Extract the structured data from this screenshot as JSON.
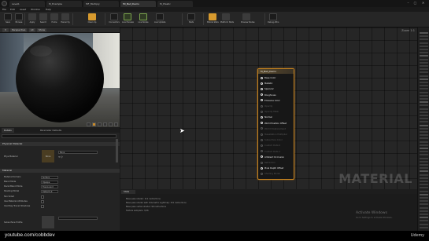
{
  "tabs": [
    "Level1",
    "M_Example",
    "MF_Multiply",
    "MI_Ball_Demo",
    "M_Plastic"
  ],
  "window_controls": [
    "–",
    "▢",
    "✕"
  ],
  "menu": [
    "File",
    "Edit",
    "Asset",
    "Window",
    "Help"
  ],
  "toolbar": [
    {
      "label": "Save",
      "icon": "save-icon",
      "style": "dk"
    },
    {
      "label": "Browse",
      "icon": "browse-icon",
      "style": "dk"
    },
    {
      "label": "Apply",
      "icon": "apply-icon",
      "style": ""
    },
    {
      "label": "Search",
      "icon": "search-icon",
      "style": ""
    },
    {
      "label": "Home",
      "icon": "home-icon",
      "style": ""
    },
    {
      "label": "Hierarchy",
      "icon": "hierarchy-icon",
      "style": ""
    },
    {
      "label": "Clean Up",
      "icon": "cleanup-icon",
      "style": "hl"
    },
    {
      "label": "Connectors",
      "icon": "connectors-icon",
      "style": "dk"
    },
    {
      "label": "Live Preview",
      "icon": "live-preview-icon",
      "style": "grn"
    },
    {
      "label": "Live Nodes",
      "icon": "live-nodes-icon",
      "style": "grn"
    },
    {
      "label": "Live Update",
      "icon": "live-update-icon",
      "style": "dk"
    },
    {
      "label": "Stats",
      "icon": "stats-icon",
      "style": "dk"
    },
    {
      "label": "Mobile Stats",
      "icon": "mobile-stats-icon",
      "style": "hl"
    },
    {
      "label": "Platform Stats",
      "icon": "platform-stats-icon",
      "style": ""
    },
    {
      "label": "Preview Nodes",
      "icon": "preview-nodes-icon",
      "style": ""
    },
    {
      "label": "Debug Attrs",
      "icon": "debug-icon",
      "style": "dk"
    }
  ],
  "viewport": {
    "tabs": [
      "Perspective",
      "Lit",
      "Show"
    ]
  },
  "details": {
    "tabs": [
      "Details",
      "Parameter Defaults"
    ],
    "categories": {
      "physical": "Physical Material",
      "material": "Material"
    },
    "phys_label": "Phys Material",
    "phys_value": "None",
    "props": [
      {
        "label": "Material Domain",
        "value": "Surface"
      },
      {
        "label": "Blend Mode",
        "value": "Opaque"
      },
      {
        "label": "Decal Blend Mode",
        "value": "Translucent"
      },
      {
        "label": "Shading Model",
        "value": "Default Lit"
      }
    ],
    "checks": [
      "Two Sided",
      "Use Material Attributes",
      "Cast Ray Traced Shadows"
    ],
    "subsurface_label": "Subsurface Profile",
    "thumb_text": "None"
  },
  "graph": {
    "zoom": "Zoom 1:1",
    "watermark": "MATERIAL",
    "node": {
      "title": "M_Ball_Demo",
      "pins": [
        {
          "label": "Base Color",
          "enabled": true
        },
        {
          "label": "Metallic",
          "enabled": true
        },
        {
          "label": "Specular",
          "enabled": true
        },
        {
          "label": "Roughness",
          "enabled": true
        },
        {
          "label": "Emissive Color",
          "enabled": true
        },
        {
          "label": "Opacity",
          "enabled": false
        },
        {
          "label": "Opacity Mask",
          "enabled": false
        },
        {
          "label": "Normal",
          "enabled": true
        },
        {
          "label": "World Position Offset",
          "enabled": true
        },
        {
          "label": "World Displacement",
          "enabled": false
        },
        {
          "label": "Tessellation Multiplier",
          "enabled": false
        },
        {
          "label": "Subsurface Color",
          "enabled": false
        },
        {
          "label": "Custom Data 0",
          "enabled": false
        },
        {
          "label": "Custom Data 1",
          "enabled": false
        },
        {
          "label": "Ambient Occlusion",
          "enabled": true
        },
        {
          "label": "Refraction",
          "enabled": false
        },
        {
          "label": "Pixel Depth Offset",
          "enabled": true
        },
        {
          "label": "Shading Model",
          "enabled": false
        }
      ]
    }
  },
  "stats": {
    "tab": "Stats",
    "lines": [
      "Base pass shader: 111 instructions",
      "Base pass shader with Volumetric Lightmap: 151 instructions",
      "Base pass vertex shader: 96 instructions",
      "Texture samplers: 3/16"
    ],
    "activate_title": "Activate Windows",
    "activate_sub": "Go to Settings to activate Windows."
  },
  "footer": {
    "left": "youtube.com/cobbdev",
    "right": "Udemy"
  }
}
